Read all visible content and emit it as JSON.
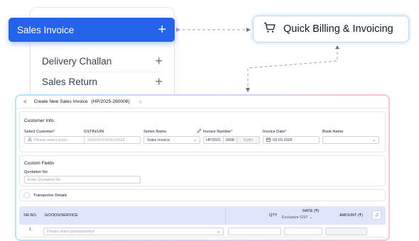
{
  "menu": {
    "sales_invoice": "Sales Invoice",
    "items": [
      "Delivery Challan",
      "Sales Return"
    ],
    "plus": "+"
  },
  "quick_billing": {
    "label": "Quick Billing & Invoicing",
    "icon": "cart-icon"
  },
  "window": {
    "back": "<",
    "title": "Create New Sales Invoice",
    "doc_number": "(HP/2025-260008)",
    "star": "☆"
  },
  "customer_info": {
    "title": "Customer Info.",
    "select_customer_label": "Select Customer",
    "select_customer_placeholder": "Please select custo...",
    "gstin_label": "GSTIN/UIN",
    "gstin_placeholder": "2XXXXXXXXXXXXZ3",
    "series_label": "Series Name",
    "series_value": "Sales Invoice",
    "invoice_number_label": "Invoice Number",
    "invoice_prefix": "HP/2021",
    "invoice_seq": "0008",
    "invoice_suffix": "Suffix",
    "invoice_date_label": "Invoice Date",
    "invoice_date": "03-03-2026",
    "book_label": "Book Name",
    "required_mark": "*"
  },
  "custom_fields": {
    "title": "Custom Fields",
    "quotation_label": "Quotation No",
    "quotation_placeholder": "Enter Quotation No"
  },
  "transporter": {
    "label": "Transporter Details"
  },
  "items_table": {
    "columns": {
      "srno": "SR.NO.",
      "goods": "GOODS/SERVICE",
      "qty": "QTY",
      "rate": "RATE (₹)",
      "rate_mode": "Exclusive GST",
      "amount": "AMOUNT (₹)"
    },
    "rows": [
      {
        "srno": "1",
        "goods_placeholder": "Please select goods/service"
      }
    ]
  },
  "colors": {
    "accent": "#2563eb",
    "header_bg": "#dfe6fb",
    "required": "#dc2626"
  }
}
